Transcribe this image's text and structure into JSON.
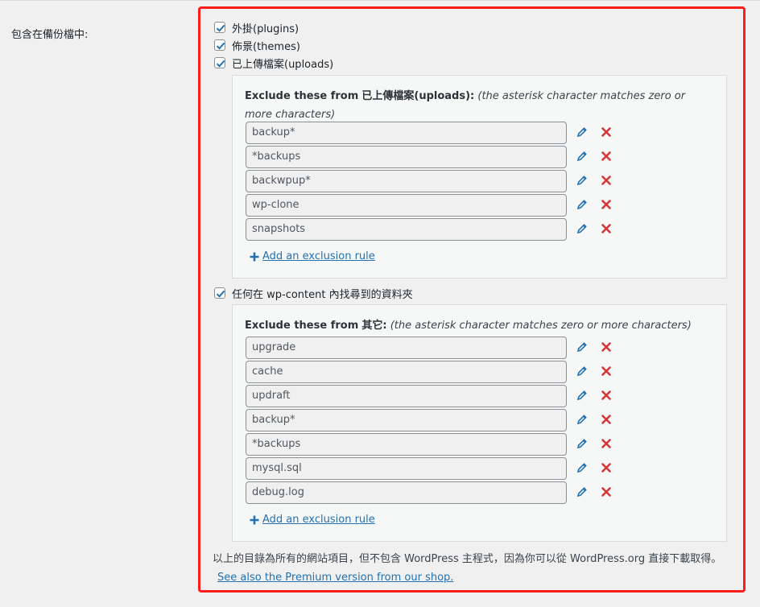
{
  "section_label": "包含在備份檔中:",
  "checkboxes": {
    "plugins": {
      "label": "外掛(plugins)",
      "checked": true
    },
    "themes": {
      "label": "佈景(themes)",
      "checked": true
    },
    "uploads": {
      "label": "已上傳檔案(uploads)",
      "checked": true
    },
    "others": {
      "label": "任何在 wp-content 內找尋到的資料夾",
      "checked": true
    }
  },
  "uploads_panel": {
    "heading_bold": "Exclude these from",
    "heading_target": "已上傳檔案(uploads):",
    "heading_note": "(the asterisk character matches zero or more characters)",
    "rules": [
      "backup*",
      "*backups",
      "backwpup*",
      "wp-clone",
      "snapshots"
    ],
    "add_label": "Add an exclusion rule"
  },
  "others_panel": {
    "heading_bold": "Exclude these from",
    "heading_target": "其它:",
    "heading_note": "(the asterisk character matches zero or more characters)",
    "rules": [
      "upgrade",
      "cache",
      "updraft",
      "backup*",
      "*backups",
      "mysql.sql",
      "debug.log"
    ],
    "add_label": "Add an exclusion rule"
  },
  "footnote": {
    "text": "以上的目錄為所有的網站項目，但不包含 WordPress 主程式，因為你可以從 WordPress.org 直接下載取得。",
    "link": "See also the Premium version from our shop."
  },
  "colors": {
    "accent": "#2271b1",
    "delete": "#d63638",
    "highlight_box": "#ff1c1c"
  },
  "icons": {
    "edit": "pencil-icon",
    "delete": "x-icon",
    "add": "plus-icon",
    "check": "checkmark-icon"
  }
}
